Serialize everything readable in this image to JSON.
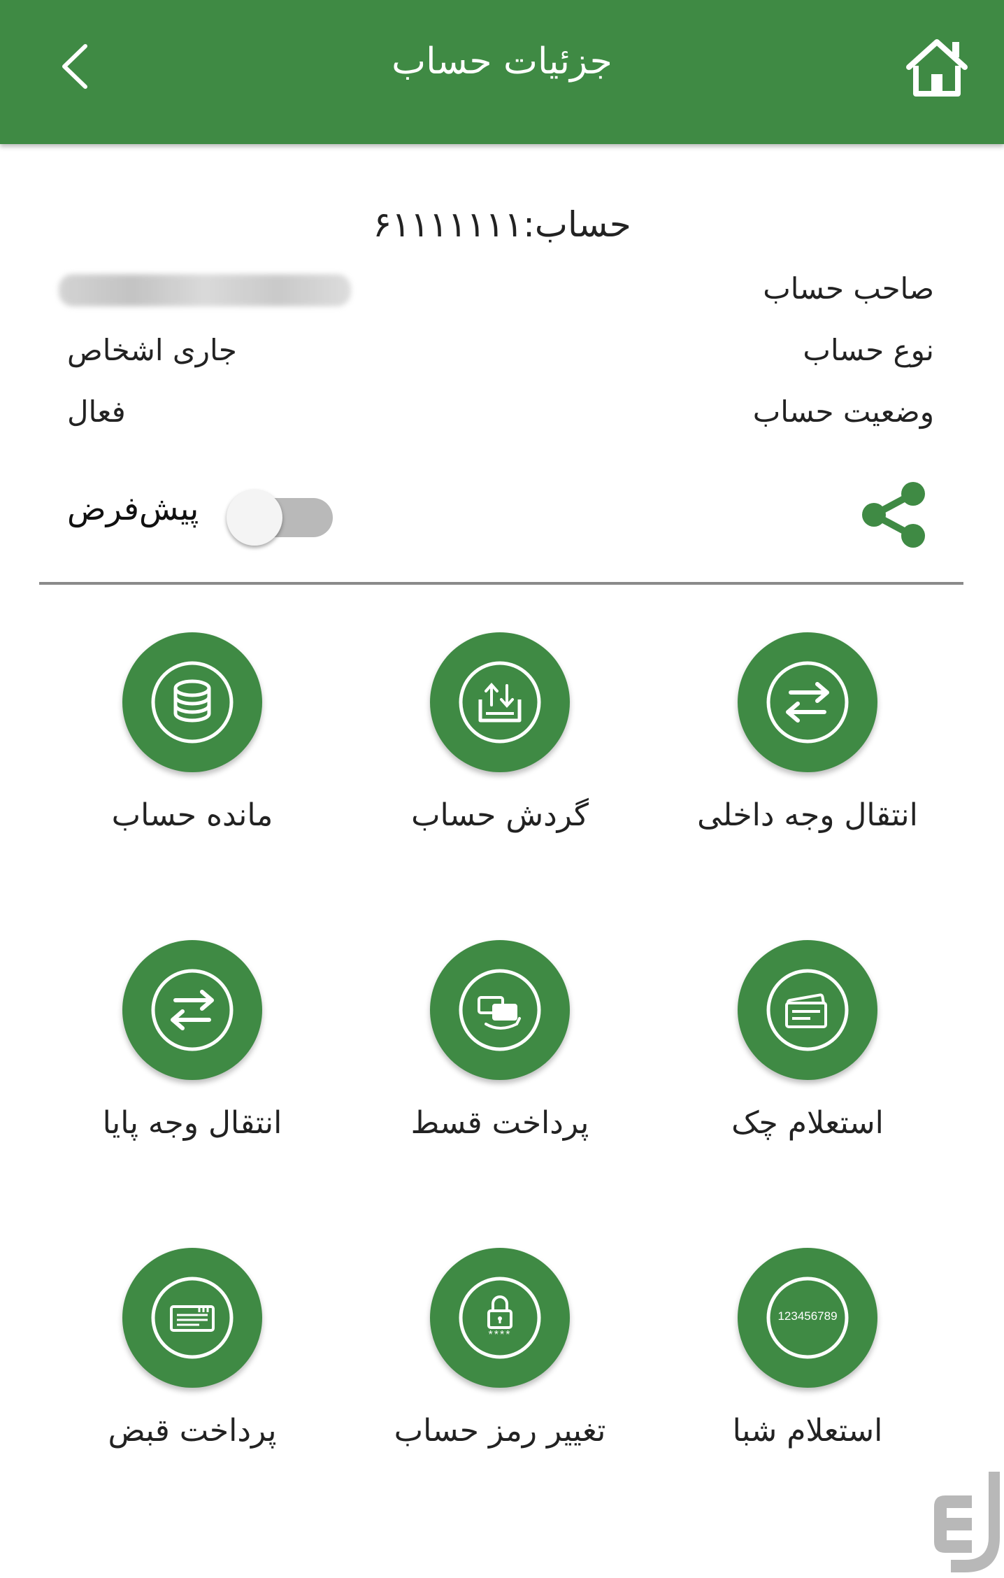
{
  "theme": {
    "brand": "#3f8a44"
  },
  "appbar": {
    "title": "جزئیات حساب",
    "back_icon": "chevron-left-icon",
    "home_icon": "home-icon"
  },
  "account": {
    "number_line": "حساب:۶۱۱۱۱۱۱۱",
    "rows": [
      {
        "label": "صاحب حساب",
        "value": ""
      },
      {
        "label": "نوع حساب",
        "value": "جاری اشخاص"
      },
      {
        "label": "وضعیت حساب",
        "value": "فعال"
      }
    ],
    "default_label": "پیش‌فرض",
    "default_on": false
  },
  "actions": [
    {
      "label": "انتقال وجه داخلی",
      "icon": "transfer-icon"
    },
    {
      "label": "گردش حساب",
      "icon": "statement-icon"
    },
    {
      "label": "مانده حساب",
      "icon": "coins-icon"
    },
    {
      "label": "استعلام چک",
      "icon": "cheque-icon"
    },
    {
      "label": "پرداخت قسط",
      "icon": "installment-icon"
    },
    {
      "label": "انتقال وجه پایا",
      "icon": "transfer-icon"
    },
    {
      "label": "استعلام شبا",
      "icon": "sheba-icon",
      "icon_text": "123456789"
    },
    {
      "label": "تغییر رمز حساب",
      "icon": "lock-icon",
      "icon_text": "****"
    },
    {
      "label": "پرداخت قبض",
      "icon": "bill-icon"
    }
  ],
  "watermark_icon": "store-logo-icon"
}
